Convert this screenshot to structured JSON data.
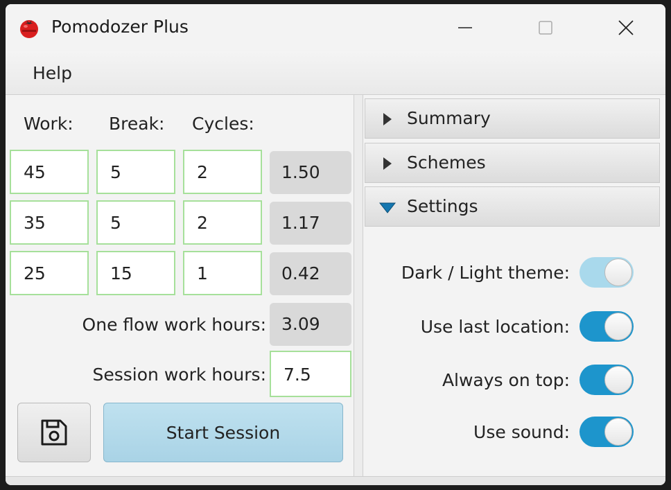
{
  "window": {
    "title": "Pomodozer Plus"
  },
  "menu": {
    "help": "Help"
  },
  "headers": {
    "work": "Work:",
    "break": "Break:",
    "cycles": "Cycles:"
  },
  "rows": [
    {
      "work": "45",
      "break": "5",
      "cycles": "2",
      "result": "1.50"
    },
    {
      "work": "35",
      "break": "5",
      "cycles": "2",
      "result": "1.17"
    },
    {
      "work": "25",
      "break": "15",
      "cycles": "1",
      "result": "0.42"
    }
  ],
  "one_flow": {
    "label": "One flow work hours:",
    "value": "3.09"
  },
  "session": {
    "label": "Session work hours:",
    "value": "7.5"
  },
  "buttons": {
    "start": "Start Session",
    "save_icon": "save-icon"
  },
  "accordion": {
    "summary": "Summary",
    "schemes": "Schemes",
    "settings": "Settings"
  },
  "settings": [
    {
      "label": "Dark / Light theme:",
      "on": true,
      "disabled": true
    },
    {
      "label": "Use last location:",
      "on": true,
      "disabled": false
    },
    {
      "label": "Always on top:",
      "on": true,
      "disabled": false
    },
    {
      "label": "Use sound:",
      "on": true,
      "disabled": false
    }
  ],
  "colors": {
    "field_border": "#a6e09a",
    "toggle_on": "#1d95cc",
    "toggle_disabled": "#a9d9ec",
    "start_button": "#b4d9ea"
  }
}
